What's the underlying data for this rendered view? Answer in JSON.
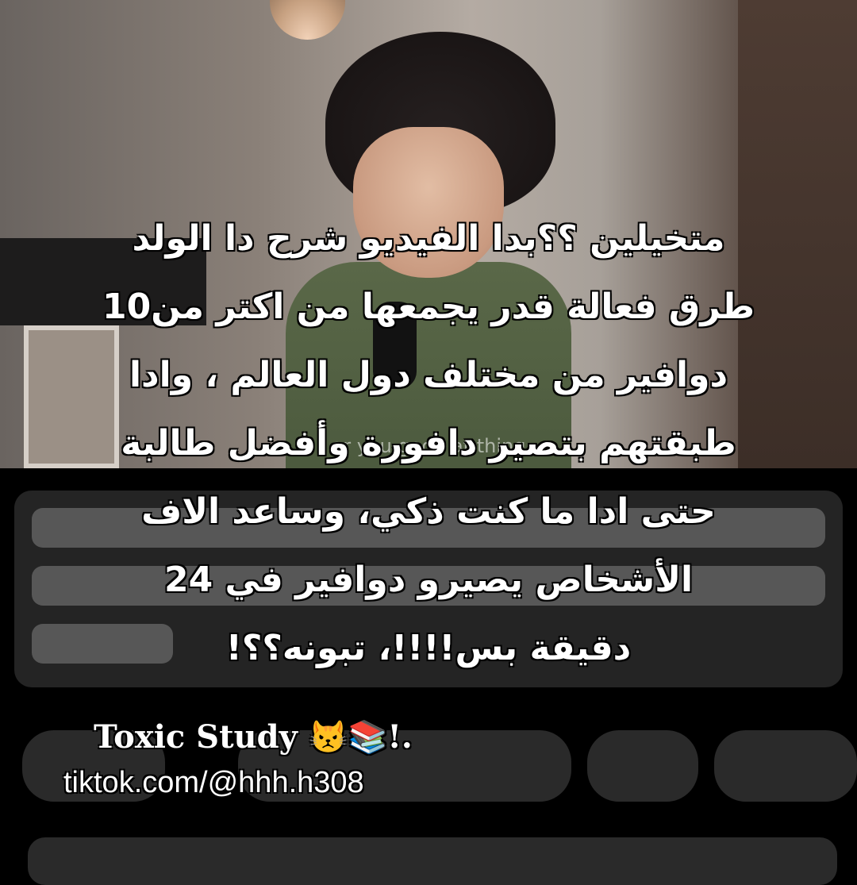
{
  "video": {
    "subtitle_fragment": "ar you good at thing"
  },
  "caption": {
    "lines": [
      "متخيلين ؟؟بدا الفيديو شرح دا الولد",
      "طرق فعالة قدر يجمعها من اكتر من10",
      "دوافير من مختلف دول العالم ، وادا",
      "طبقتهم بتصير دافورة وأفضل طالبة",
      "حتى ادا ما كنت ذكي، وساعد الاف",
      "الأشخاص يصيرو دوافير في 24",
      "دقيقة بس!!!!، تبونه؟؟!"
    ]
  },
  "watermark": {
    "name": "Toxic Study 😾📚!.",
    "handle": "tiktok.com/@hhh.h308"
  },
  "colors": {
    "background": "#000000",
    "card": "#242424",
    "skeleton": "#575757"
  }
}
